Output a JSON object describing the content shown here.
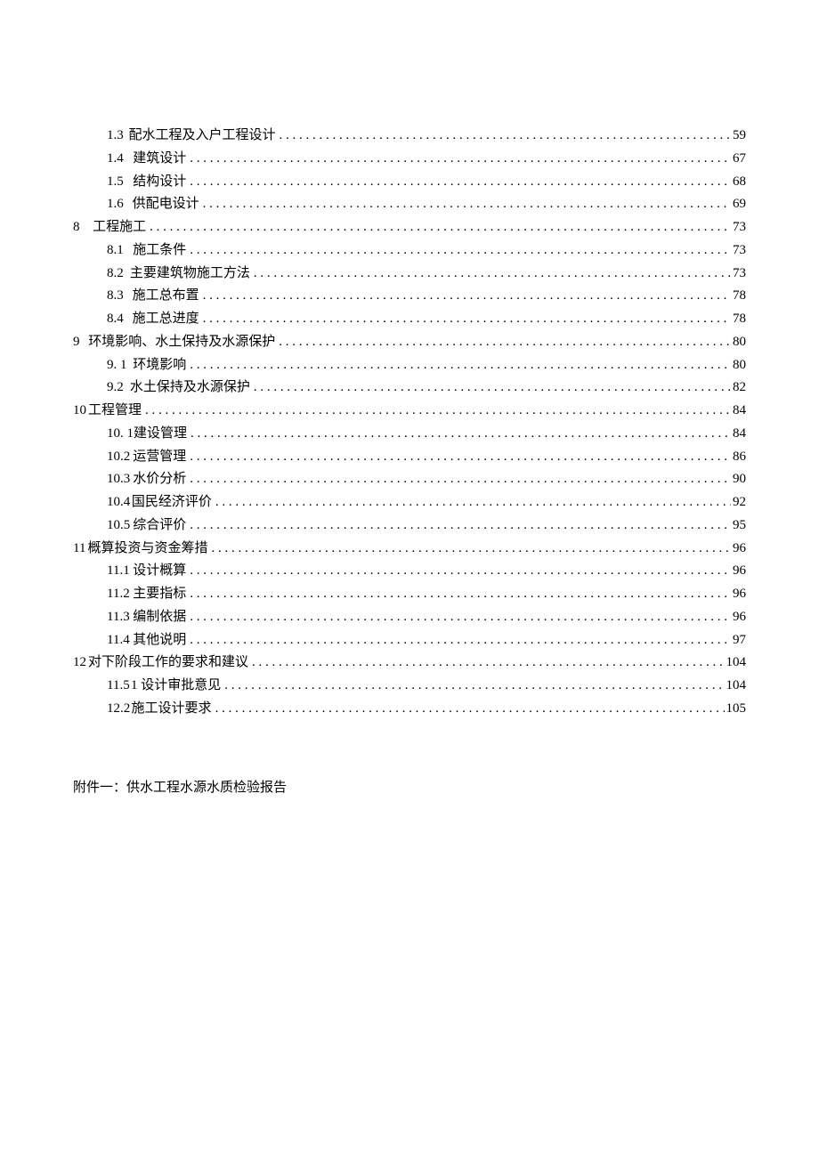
{
  "toc": [
    {
      "level": 2,
      "num": "1.3",
      "title": "配水工程及入户工程设计",
      "page": "59"
    },
    {
      "level": 2,
      "num": "1.4",
      "title": "建筑设计",
      "page": "67"
    },
    {
      "level": 2,
      "num": "1.5",
      "title": "结构设计",
      "page": "68"
    },
    {
      "level": 2,
      "num": "1.6",
      "title": "供配电设计",
      "page": "69"
    },
    {
      "level": 1,
      "num": "8",
      "title": "工程施工",
      "page": "73"
    },
    {
      "level": 2,
      "num": "8.1",
      "title": "施工条件",
      "page": "73"
    },
    {
      "level": 2,
      "num": "8.2",
      "title": "主要建筑物施工方法",
      "page": "73"
    },
    {
      "level": 2,
      "num": "8.3",
      "title": "施工总布置",
      "page": "78"
    },
    {
      "level": 2,
      "num": "8.4",
      "title": "施工总进度",
      "page": "78"
    },
    {
      "level": 1,
      "num": "9",
      "title": "环境影响、水土保持及水源保护",
      "page": "80"
    },
    {
      "level": 2,
      "num": "9.  1",
      "title": "环境影响",
      "page": "80"
    },
    {
      "level": 2,
      "num": "9.2",
      "title": "水土保持及水源保护",
      "page": "82"
    },
    {
      "level": 1,
      "num": "10",
      "title": "工程管理",
      "page": "84",
      "compact": true
    },
    {
      "level": 2,
      "num": "10.  1",
      "title": "建设管理",
      "page": "84"
    },
    {
      "level": 2,
      "num": "10.2",
      "title": "运营管理",
      "page": "86"
    },
    {
      "level": 2,
      "num": "10.3",
      "title": "水价分析",
      "page": "90"
    },
    {
      "level": 2,
      "num": "10.4",
      "title": "国民经济评价",
      "page": "92"
    },
    {
      "level": 2,
      "num": "10.5",
      "title": "综合评价",
      "page": "95"
    },
    {
      "level": 1,
      "num": "11",
      "title": "概算投资与资金筹措",
      "page": "96",
      "compact": true
    },
    {
      "level": 2,
      "num": "11.1",
      "title": "设计概算",
      "page": "96"
    },
    {
      "level": 2,
      "num": "11.2",
      "title": "主要指标",
      "page": "96"
    },
    {
      "level": 2,
      "num": "11.3",
      "title": "编制依据",
      "page": "96"
    },
    {
      "level": 2,
      "num": "11.4",
      "title": "其他说明",
      "page": "97"
    },
    {
      "level": 1,
      "num": "12",
      "title": "对下阶段工作的要求和建议",
      "page": "104",
      "compact": true
    },
    {
      "level": 2,
      "num": "11.5",
      "title": "1 设计审批意见",
      "page": "104"
    },
    {
      "level": 2,
      "num": "12.2",
      "title": "施工设计要求",
      "page": "105"
    }
  ],
  "appendix": "附件一：供水工程水源水质检验报告"
}
